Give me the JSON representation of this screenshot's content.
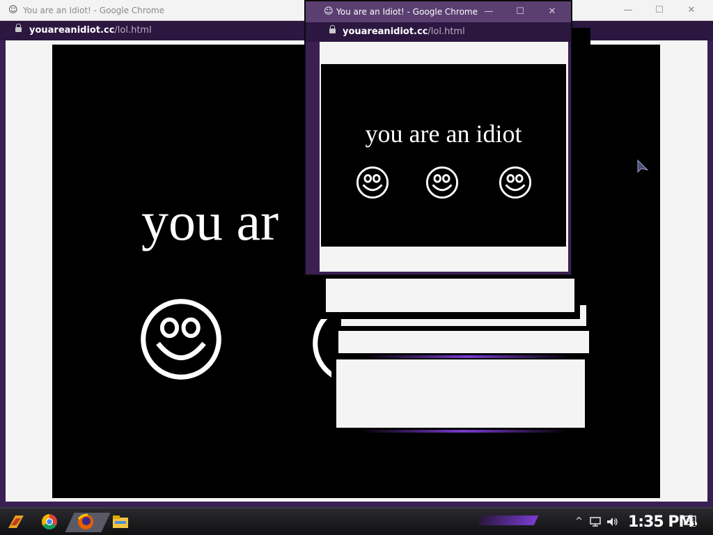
{
  "main_window": {
    "tab_title": "You are an Idiot! - Google Chrome",
    "url_host": "youareanidiot.cc",
    "url_path": "/lol.html",
    "page_text": "you are an idiot",
    "visible_text": "you ar"
  },
  "popup_window": {
    "tab_title": "You are an Idiot! - Google Chrome",
    "url_host": "youareanidiot.cc",
    "url_path": "/lol.html",
    "page_text": "you are an idiot"
  },
  "window_controls": {
    "minimize": "—",
    "maximize": "☐",
    "close": "✕"
  },
  "taskbar": {
    "pinned": [
      "start-icon",
      "chrome-icon",
      "firefox-icon",
      "file-explorer-icon"
    ],
    "clock": "1:35 PM",
    "notification_count": "1"
  },
  "colors": {
    "accent_purple": "#7a3bd0",
    "addressbar": "#2b1740",
    "popup_titlebar": "#5a3f70"
  }
}
